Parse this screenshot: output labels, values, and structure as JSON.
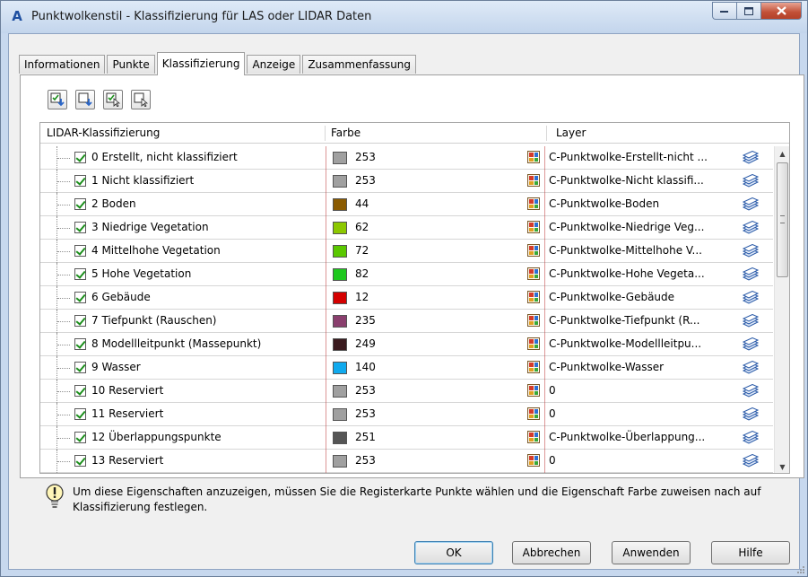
{
  "window": {
    "title": "Punktwolkenstil - Klassifizierung für LAS oder LIDAR Daten",
    "app_icon": "A"
  },
  "tabs": [
    {
      "label": "Informationen",
      "active": false
    },
    {
      "label": "Punkte",
      "active": false
    },
    {
      "label": "Klassifizierung",
      "active": true
    },
    {
      "label": "Anzeige",
      "active": false
    },
    {
      "label": "Zusammenfassung",
      "active": false
    }
  ],
  "grid": {
    "headers": {
      "classification": "LIDAR-Klassifizierung",
      "color": "Farbe",
      "layer": "Layer"
    },
    "rows": [
      {
        "label": "0 Erstellt, nicht klassifiziert",
        "checked": true,
        "color_hex": "#a0a0a0",
        "color_value": "253",
        "layer": "C-Punktwolke-Erstellt-nicht ..."
      },
      {
        "label": "1 Nicht klassifiziert",
        "checked": true,
        "color_hex": "#a0a0a0",
        "color_value": "253",
        "layer": "C-Punktwolke-Nicht klassifi..."
      },
      {
        "label": "2 Boden",
        "checked": true,
        "color_hex": "#8a5a00",
        "color_value": "44",
        "layer": "C-Punktwolke-Boden"
      },
      {
        "label": "3 Niedrige Vegetation",
        "checked": true,
        "color_hex": "#8cc800",
        "color_value": "62",
        "layer": "C-Punktwolke-Niedrige Veg..."
      },
      {
        "label": "4 Mittelhohe Vegetation",
        "checked": true,
        "color_hex": "#5ac800",
        "color_value": "72",
        "layer": "C-Punktwolke-Mittelhohe V..."
      },
      {
        "label": "5 Hohe Vegetation",
        "checked": true,
        "color_hex": "#1ec81e",
        "color_value": "82",
        "layer": "C-Punktwolke-Hohe Vegeta..."
      },
      {
        "label": "6 Gebäude",
        "checked": true,
        "color_hex": "#d40000",
        "color_value": "12",
        "layer": "C-Punktwolke-Gebäude"
      },
      {
        "label": "7 Tiefpunkt (Rauschen)",
        "checked": true,
        "color_hex": "#8a3f6e",
        "color_value": "235",
        "layer": "C-Punktwolke-Tiefpunkt (R..."
      },
      {
        "label": "8 Modellleitpunkt (Massepunkt)",
        "checked": true,
        "color_hex": "#3a1a1e",
        "color_value": "249",
        "layer": "C-Punktwolke-Modellleitpu..."
      },
      {
        "label": "9 Wasser",
        "checked": true,
        "color_hex": "#10aaee",
        "color_value": "140",
        "layer": "C-Punktwolke-Wasser"
      },
      {
        "label": "10 Reserviert",
        "checked": true,
        "color_hex": "#a0a0a0",
        "color_value": "253",
        "layer": "0"
      },
      {
        "label": "11 Reserviert",
        "checked": true,
        "color_hex": "#a0a0a0",
        "color_value": "253",
        "layer": "0"
      },
      {
        "label": "12 Überlappungspunkte",
        "checked": true,
        "color_hex": "#555555",
        "color_value": "251",
        "layer": "C-Punktwolke-Überlappung..."
      },
      {
        "label": "13 Reserviert",
        "checked": true,
        "color_hex": "#a0a0a0",
        "color_value": "253",
        "layer": "0"
      }
    ]
  },
  "info": {
    "text": "Um diese Eigenschaften anzuzeigen, müssen Sie die Registerkarte Punkte wählen und die Eigenschaft Farbe zuweisen nach auf Klassifizierung festlegen."
  },
  "buttons": {
    "ok": "OK",
    "cancel": "Abbrechen",
    "apply": "Anwenden",
    "help": "Hilfe"
  },
  "icons": {
    "toolbar": [
      "check-all-down-icon",
      "uncheck-all-down-icon",
      "check-selected-icon",
      "uncheck-selected-icon"
    ],
    "color_picker": "color-palette-icon",
    "layer": "layer-stack-icon",
    "info": "lightbulb-icon"
  }
}
